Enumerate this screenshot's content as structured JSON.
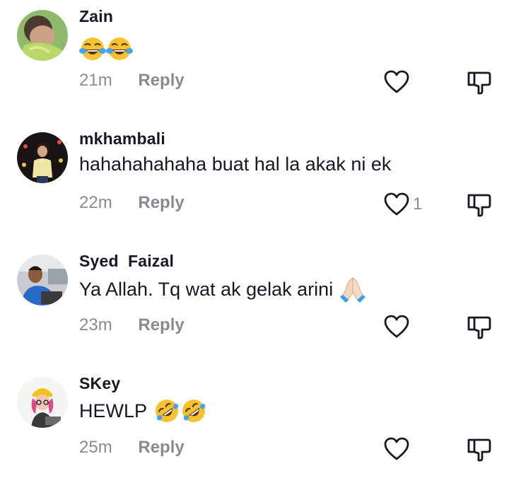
{
  "comments": [
    {
      "username": "Zain",
      "text": "",
      "emojis": [
        "tears-of-joy-emoji",
        "tears-of-joy-emoji"
      ],
      "time": "21m",
      "reply_label": "Reply",
      "like_count": ""
    },
    {
      "username": "mkhambali",
      "text": "hahahahahaha buat hal la akak ni ek",
      "emojis": [],
      "time": "22m",
      "reply_label": "Reply",
      "like_count": "1"
    },
    {
      "username": "Syed  Faizal",
      "text": "Ya Allah. Tq wat ak gelak arini",
      "emojis": [
        "folded-hands-emoji"
      ],
      "time": "23m",
      "reply_label": "Reply",
      "like_count": ""
    },
    {
      "username": "SKey",
      "text": "HEWLP",
      "emojis": [
        "rolling-on-floor-laughing-emoji",
        "rolling-on-floor-laughing-emoji"
      ],
      "time": "25m",
      "reply_label": "Reply",
      "like_count": ""
    }
  ],
  "icons": {
    "like": "heart-outline-icon",
    "dislike": "thumbs-down-outline-icon"
  },
  "colors": {
    "text": "#161823",
    "muted": "#8a8b91",
    "icon": "#161823"
  }
}
